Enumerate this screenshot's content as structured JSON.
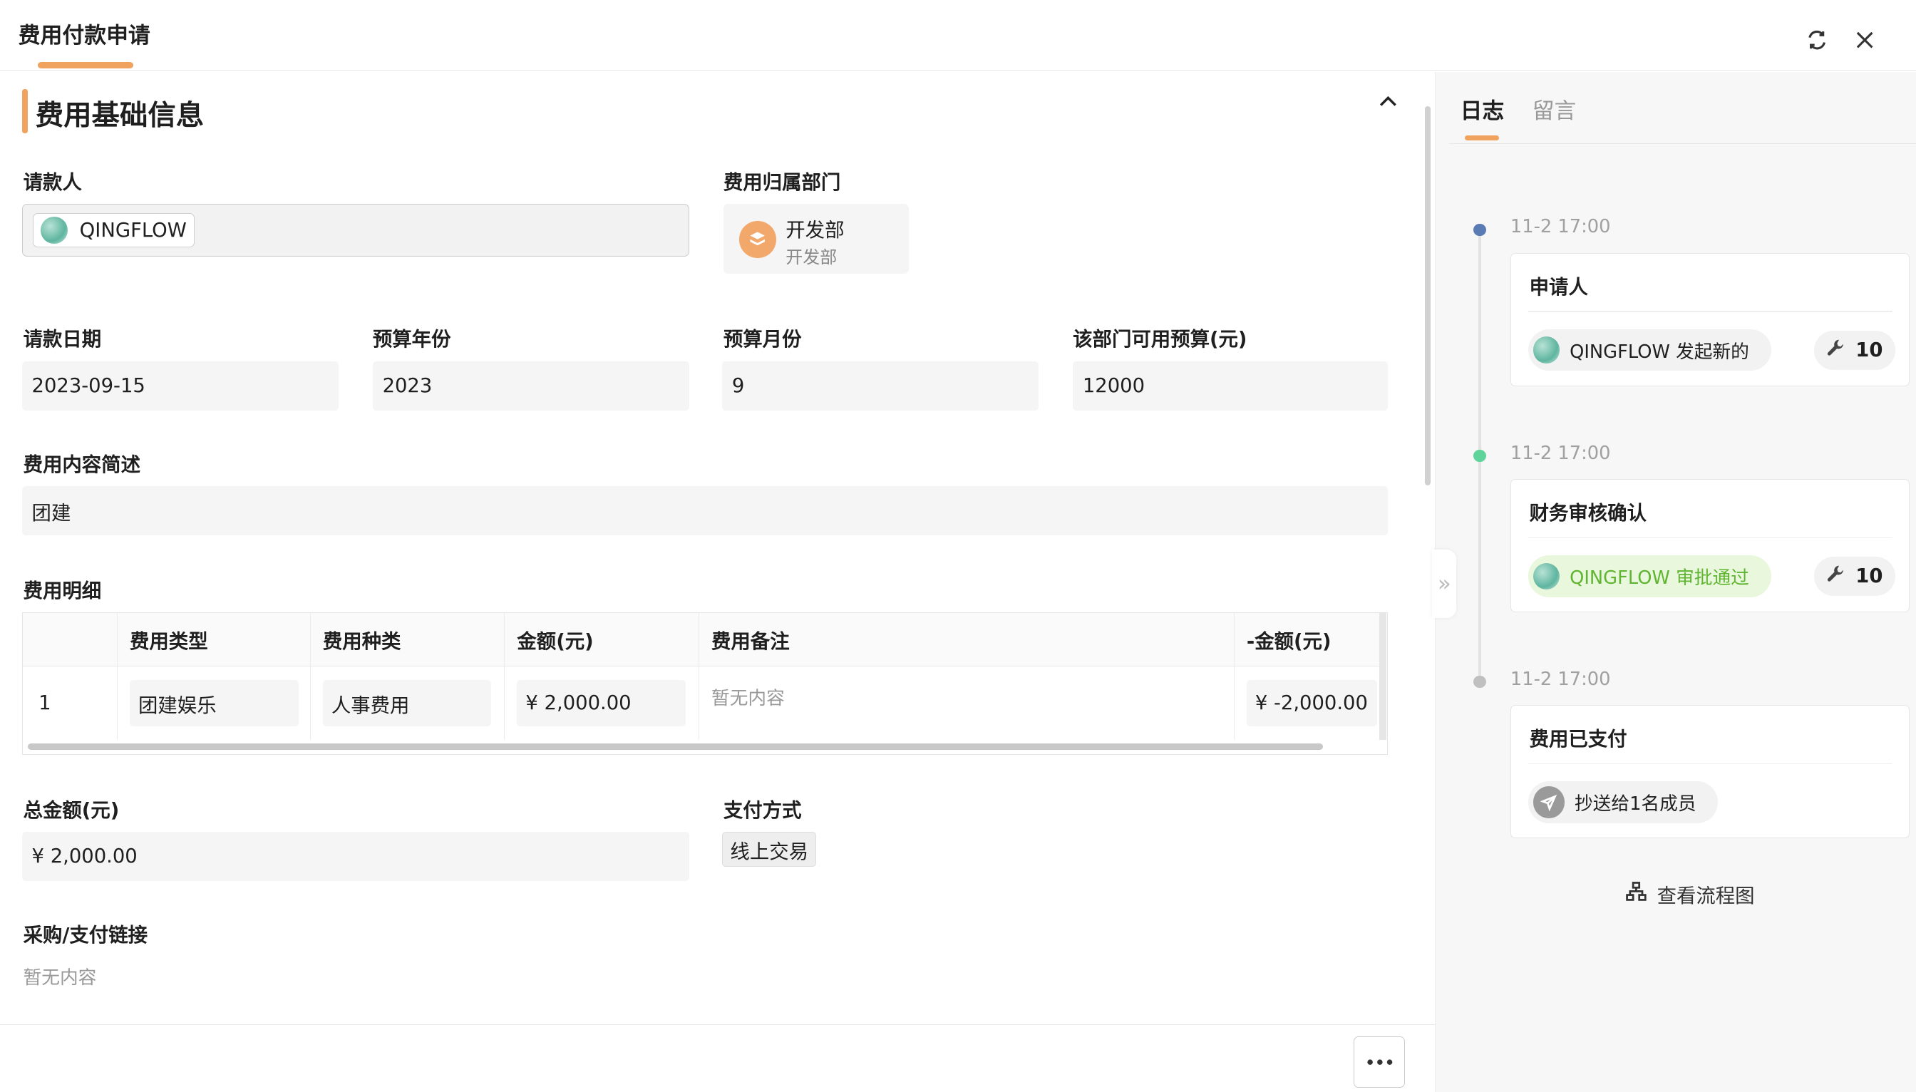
{
  "header": {
    "title": "费用付款申请"
  },
  "section": {
    "title": "费用基础信息"
  },
  "fields": {
    "requester_label": "请款人",
    "requester_value": "QINGFLOW",
    "dept_label": "费用归属部门",
    "dept_name": "开发部",
    "dept_sub": "开发部",
    "date_label": "请款日期",
    "date_value": "2023-09-15",
    "year_label": "预算年份",
    "year_value": "2023",
    "month_label": "预算月份",
    "month_value": "9",
    "budget_label": "该部门可用预算(元)",
    "budget_value": "12000",
    "desc_label": "费用内容简述",
    "desc_value": "团建",
    "detail_label": "费用明细",
    "total_label": "总金额(元)",
    "total_value": "¥ 2,000.00",
    "pay_label": "支付方式",
    "pay_value": "线上交易",
    "link_label": "采购/支付链接",
    "link_value": "暂无内容"
  },
  "table": {
    "headers": [
      "费用类型",
      "费用种类",
      "金额(元)",
      "费用备注",
      "-金额(元)"
    ],
    "rows": [
      {
        "index": "1",
        "type": "团建娱乐",
        "kind": "人事费用",
        "amount": "¥ 2,000.00",
        "note": "暂无内容",
        "neg_amount": "¥ -2,000.00"
      }
    ]
  },
  "right": {
    "tabs": [
      "日志",
      "留言"
    ],
    "timeline": [
      {
        "time": "11-2 17:00",
        "title": "申请人",
        "pill": "QINGFLOW 发起新的",
        "count": "10",
        "dot": "#5b7bb5"
      },
      {
        "time": "11-2 17:00",
        "title": "财务审核确认",
        "pill": "QINGFLOW 审批通过",
        "count": "10",
        "dot": "#5fd49a"
      },
      {
        "time": "11-2 17:00",
        "title": "费用已支付",
        "pill": "抄送给1名成员",
        "dot": "#c0c0c0"
      }
    ],
    "flow_link": "查看流程图"
  },
  "colors": {
    "accent": "#f0a35e",
    "approved_bg": "#e9f8dc",
    "approved_text": "#5fb531"
  }
}
